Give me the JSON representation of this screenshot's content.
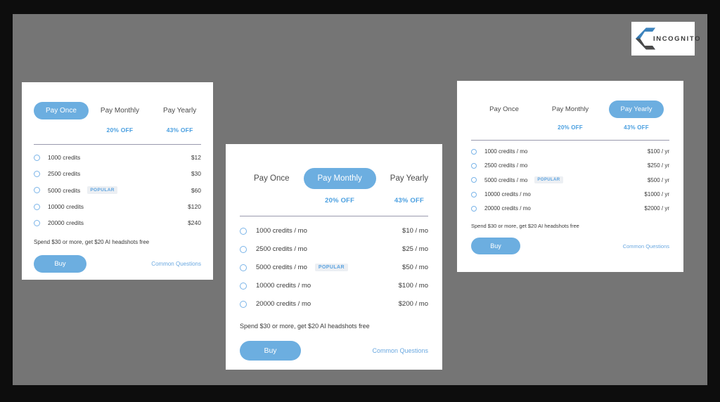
{
  "brand": {
    "logo_text": "INCOGNITO",
    "logo_icon": "hexagon-c-logo-icon",
    "accent_color": "#6CAEE0",
    "link_color": "#6aa8e0",
    "badge_bg": "#eceff3",
    "page_bg": "#757575",
    "frame_bg": "#0d0d0d"
  },
  "cards": [
    {
      "id": "pay-once",
      "active_tab": "Pay Once",
      "tabs": [
        {
          "label": "Pay Once",
          "discount": "",
          "active": true
        },
        {
          "label": "Pay Monthly",
          "discount": "20% OFF",
          "active": false
        },
        {
          "label": "Pay Yearly",
          "discount": "43% OFF",
          "active": false
        }
      ],
      "plans": [
        {
          "label": "1000 credits",
          "badge": "",
          "price": "$12"
        },
        {
          "label": "2500 credits",
          "badge": "",
          "price": "$30"
        },
        {
          "label": "5000 credits",
          "badge": "POPULAR",
          "price": "$60"
        },
        {
          "label": "10000 credits",
          "badge": "",
          "price": "$120"
        },
        {
          "label": "20000 credits",
          "badge": "",
          "price": "$240"
        }
      ],
      "note": "Spend $30 or more, get $20 AI headshots free",
      "buy_label": "Buy",
      "faq_label": "Common Questions"
    },
    {
      "id": "pay-monthly",
      "active_tab": "Pay Monthly",
      "tabs": [
        {
          "label": "Pay Once",
          "discount": "",
          "active": false
        },
        {
          "label": "Pay Monthly",
          "discount": "20% OFF",
          "active": true
        },
        {
          "label": "Pay Yearly",
          "discount": "43% OFF",
          "active": false
        }
      ],
      "plans": [
        {
          "label": "1000 credits / mo",
          "badge": "",
          "price": "$10 / mo"
        },
        {
          "label": "2500 credits / mo",
          "badge": "",
          "price": "$25 / mo"
        },
        {
          "label": "5000 credits / mo",
          "badge": "POPULAR",
          "price": "$50 / mo"
        },
        {
          "label": "10000 credits / mo",
          "badge": "",
          "price": "$100 / mo"
        },
        {
          "label": "20000 credits / mo",
          "badge": "",
          "price": "$200 / mo"
        }
      ],
      "note": "Spend $30 or more, get $20 AI headshots free",
      "buy_label": "Buy",
      "faq_label": "Common Questions"
    },
    {
      "id": "pay-yearly",
      "active_tab": "Pay Yearly",
      "tabs": [
        {
          "label": "Pay Once",
          "discount": "",
          "active": false
        },
        {
          "label": "Pay Monthly",
          "discount": "20% OFF",
          "active": false
        },
        {
          "label": "Pay Yearly",
          "discount": "43% OFF",
          "active": true
        }
      ],
      "plans": [
        {
          "label": "1000 credits / mo",
          "badge": "",
          "price": "$100 / yr"
        },
        {
          "label": "2500 credits / mo",
          "badge": "",
          "price": "$250 / yr"
        },
        {
          "label": "5000 credits / mo",
          "badge": "POPULAR",
          "price": "$500 / yr"
        },
        {
          "label": "10000 credits / mo",
          "badge": "",
          "price": "$1000 / yr"
        },
        {
          "label": "20000 credits / mo",
          "badge": "",
          "price": "$2000 / yr"
        }
      ],
      "note": "Spend $30 or more, get $20 AI headshots free",
      "buy_label": "Buy",
      "faq_label": "Common Questions"
    }
  ]
}
